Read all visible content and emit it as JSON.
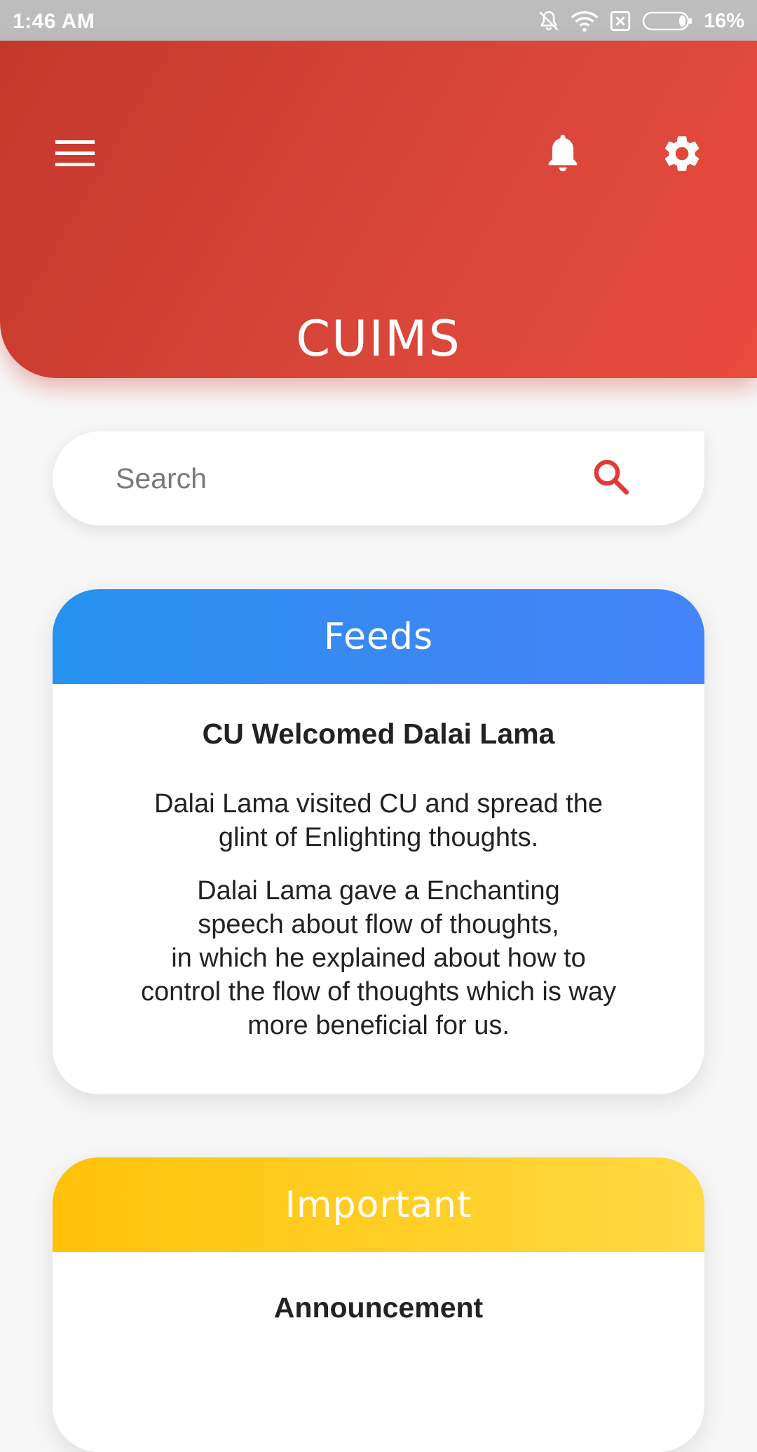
{
  "status_bar": {
    "time": "1:46 AM",
    "battery_percent": "16%",
    "battery_level": 0.16,
    "icons": [
      "silent-bell-icon",
      "wifi-icon",
      "sim-x-icon",
      "battery-icon"
    ]
  },
  "header": {
    "title": "CUIMS",
    "icons": [
      "menu-icon",
      "notification-bell-icon",
      "settings-gear-icon"
    ],
    "color_start": "#c4382b",
    "color_end": "#e84b3c"
  },
  "search": {
    "placeholder": "Search",
    "icon": "search-icon",
    "icon_color": "#e53935"
  },
  "feeds": {
    "heading": "Feeds",
    "headline": "CU Welcomed Dalai Lama",
    "paragraph_1": "Dalai Lama visited CU and spread the\nglint of Enlighting thoughts.",
    "paragraph_2": "Dalai Lama gave a Enchanting\nspeech about flow of thoughts,\nin which he explained about how to\ncontrol the flow of thoughts which is way\nmore beneficial for us.",
    "color": "#3d87f2"
  },
  "important": {
    "heading": "Important",
    "headline": "Announcement",
    "color": "#ffc20a"
  }
}
